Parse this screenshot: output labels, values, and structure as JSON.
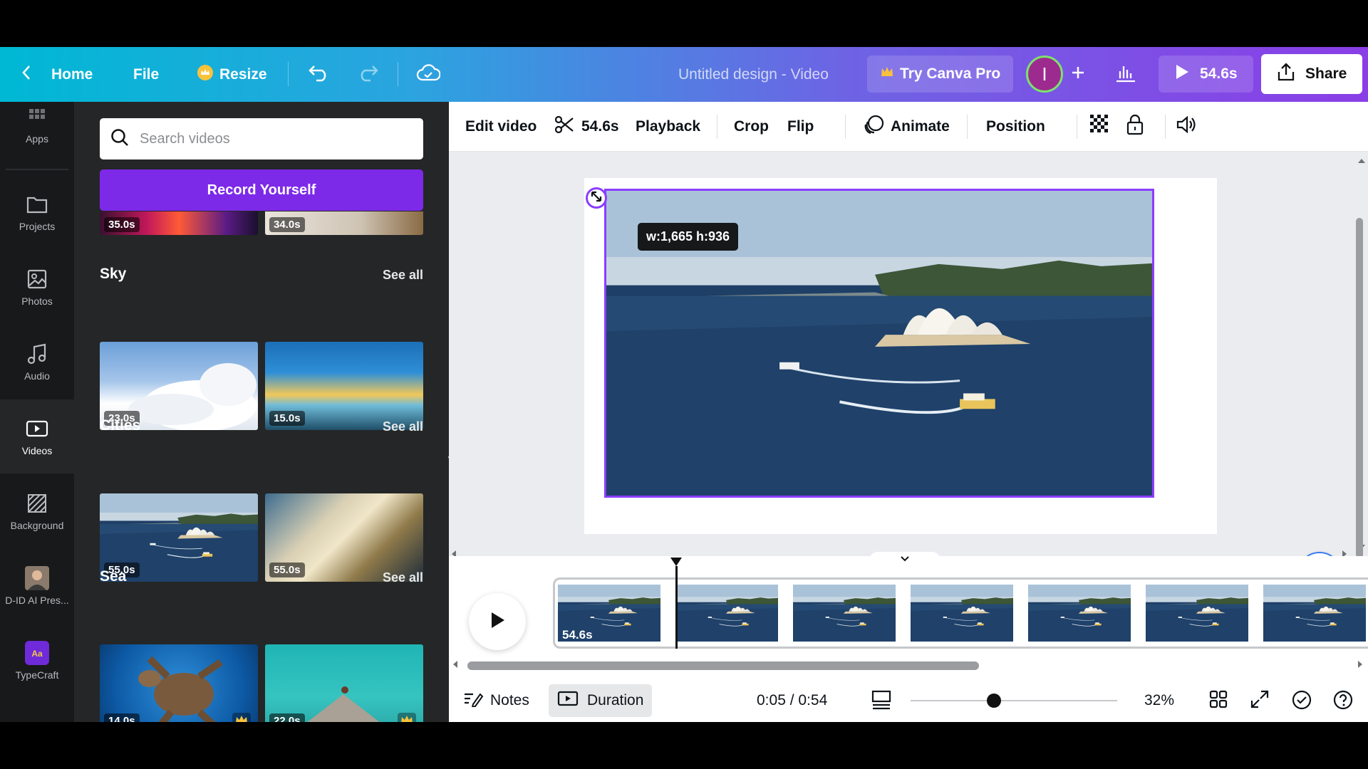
{
  "topbar": {
    "home_label": "Home",
    "file_label": "File",
    "resize_label": "Resize",
    "design_title": "Untitled design - Video",
    "pro_label": "Try Canva Pro",
    "avatar_initial": "I",
    "present_duration": "54.6s",
    "share_label": "Share"
  },
  "rail": {
    "items": [
      {
        "label": "Apps"
      },
      {
        "label": "Projects"
      },
      {
        "label": "Photos"
      },
      {
        "label": "Audio"
      },
      {
        "label": "Videos"
      },
      {
        "label": "Background"
      },
      {
        "label": "D-ID AI Pres..."
      },
      {
        "label": "TypeCraft"
      }
    ]
  },
  "panel": {
    "search_placeholder": "Search videos",
    "record_label": "Record Yourself",
    "top_durations": [
      "35.0s",
      "34.0s"
    ],
    "sections": [
      {
        "title": "Sky",
        "see_all": "See all",
        "durations": [
          "23.0s",
          "15.0s"
        ]
      },
      {
        "title": "Cities",
        "see_all": "See all",
        "durations": [
          "55.0s",
          "55.0s"
        ]
      },
      {
        "title": "Sea",
        "see_all": "See all",
        "durations": [
          "14.0s",
          "22.0s"
        ]
      }
    ]
  },
  "toolbar": {
    "edit_video": "Edit video",
    "trim_duration": "54.6s",
    "playback": "Playback",
    "crop": "Crop",
    "flip": "Flip",
    "animate": "Animate",
    "position": "Position"
  },
  "canvas": {
    "size_tooltip": "w:1,665 h:936"
  },
  "timeline": {
    "clip_duration": "54.6s",
    "frame_count": 7
  },
  "bottombar": {
    "notes_label": "Notes",
    "duration_label": "Duration",
    "time_readout": "0:05 / 0:54",
    "zoom_value": "32%"
  },
  "colors": {
    "accent": "#8b3dff",
    "record_button": "#7d2ae8",
    "panel_bg": "#252627",
    "rail_bg": "#18191b"
  }
}
